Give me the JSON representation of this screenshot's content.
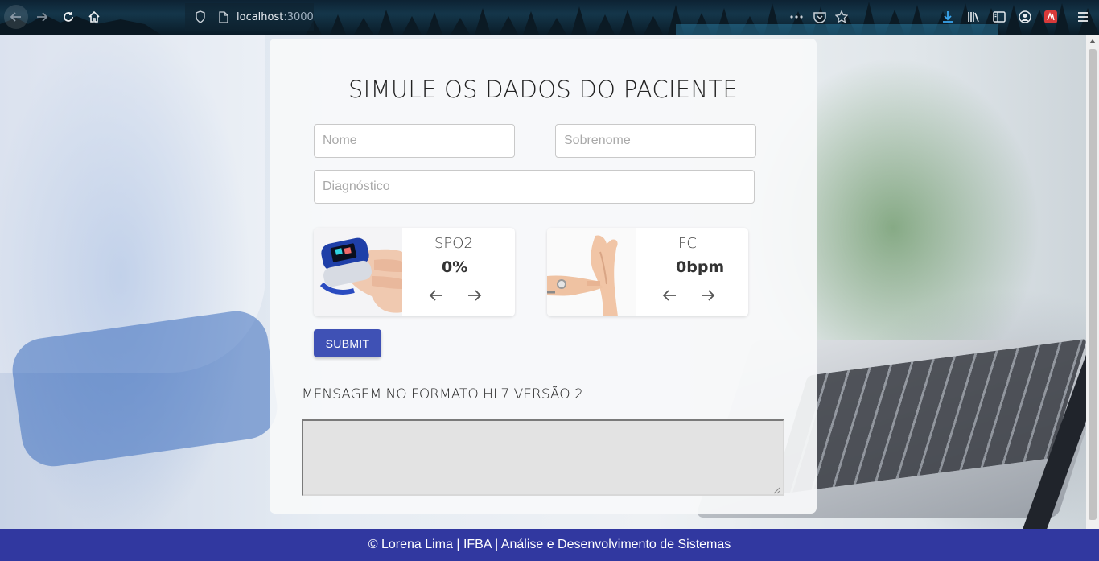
{
  "browser": {
    "url_host": "localhost",
    "url_port": ":3000",
    "icons": [
      "back-icon",
      "forward-icon",
      "reload-icon",
      "home-icon",
      "shield-icon",
      "page-icon",
      "more-icon",
      "pocket-icon",
      "star-icon",
      "download-icon",
      "library-icon",
      "sidebar-icon",
      "account-icon",
      "extension-icon",
      "menu-icon"
    ]
  },
  "form": {
    "title": "SIMULE OS DADOS DO PACIENTE",
    "nome_placeholder": "Nome",
    "sobrenome_placeholder": "Sobrenome",
    "diagnostico_placeholder": "Diagnóstico"
  },
  "vitals": {
    "spo2": {
      "label": "SPO2",
      "value": "0%"
    },
    "fc": {
      "label": "FC",
      "value": "0bpm"
    }
  },
  "submit_label": "SUBMIT",
  "message": {
    "title": "MENSAGEM NO FORMATO HL7 VERSÃO 2",
    "content": ""
  },
  "footer": {
    "text": "© Lorena Lima | IFBA | Análise e Desenvolvimento de Sistemas"
  },
  "colors": {
    "primary": "#3f51b5",
    "footer_bg": "#3138a0"
  }
}
